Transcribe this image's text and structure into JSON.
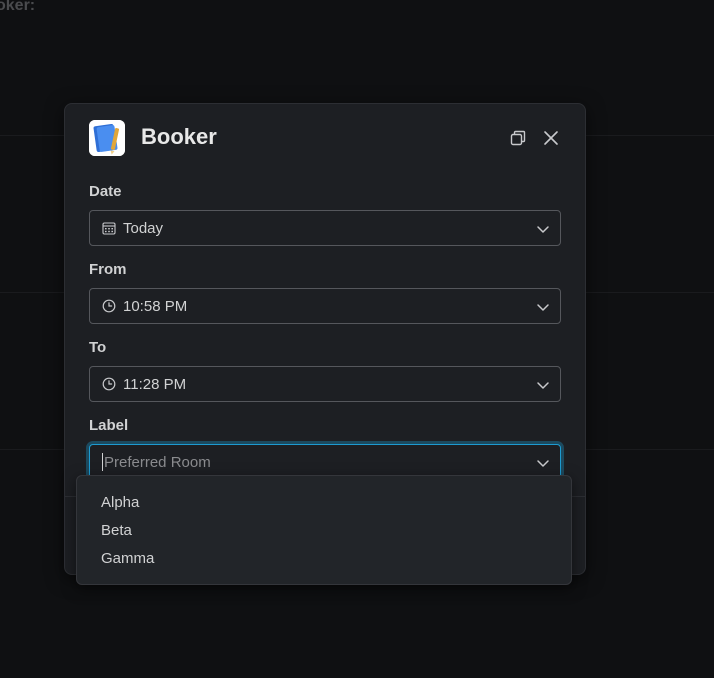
{
  "background": {
    "title": "oker:"
  },
  "modal": {
    "title": "Booker",
    "app_icon": "notebook-icon",
    "colors": {
      "accent": "#1d9bd1",
      "surface": "#1d1f23",
      "border": "#55575c"
    }
  },
  "fields": {
    "date": {
      "label": "Date",
      "value": "Today",
      "icon": "calendar-icon"
    },
    "from": {
      "label": "From",
      "value": "10:58 PM",
      "icon": "clock-icon"
    },
    "to": {
      "label": "To",
      "value": "11:28 PM",
      "icon": "clock-icon"
    },
    "label": {
      "label": "Label",
      "placeholder": "Preferred Room"
    }
  },
  "dropdown": {
    "options": [
      "Alpha",
      "Beta",
      "Gamma"
    ]
  }
}
